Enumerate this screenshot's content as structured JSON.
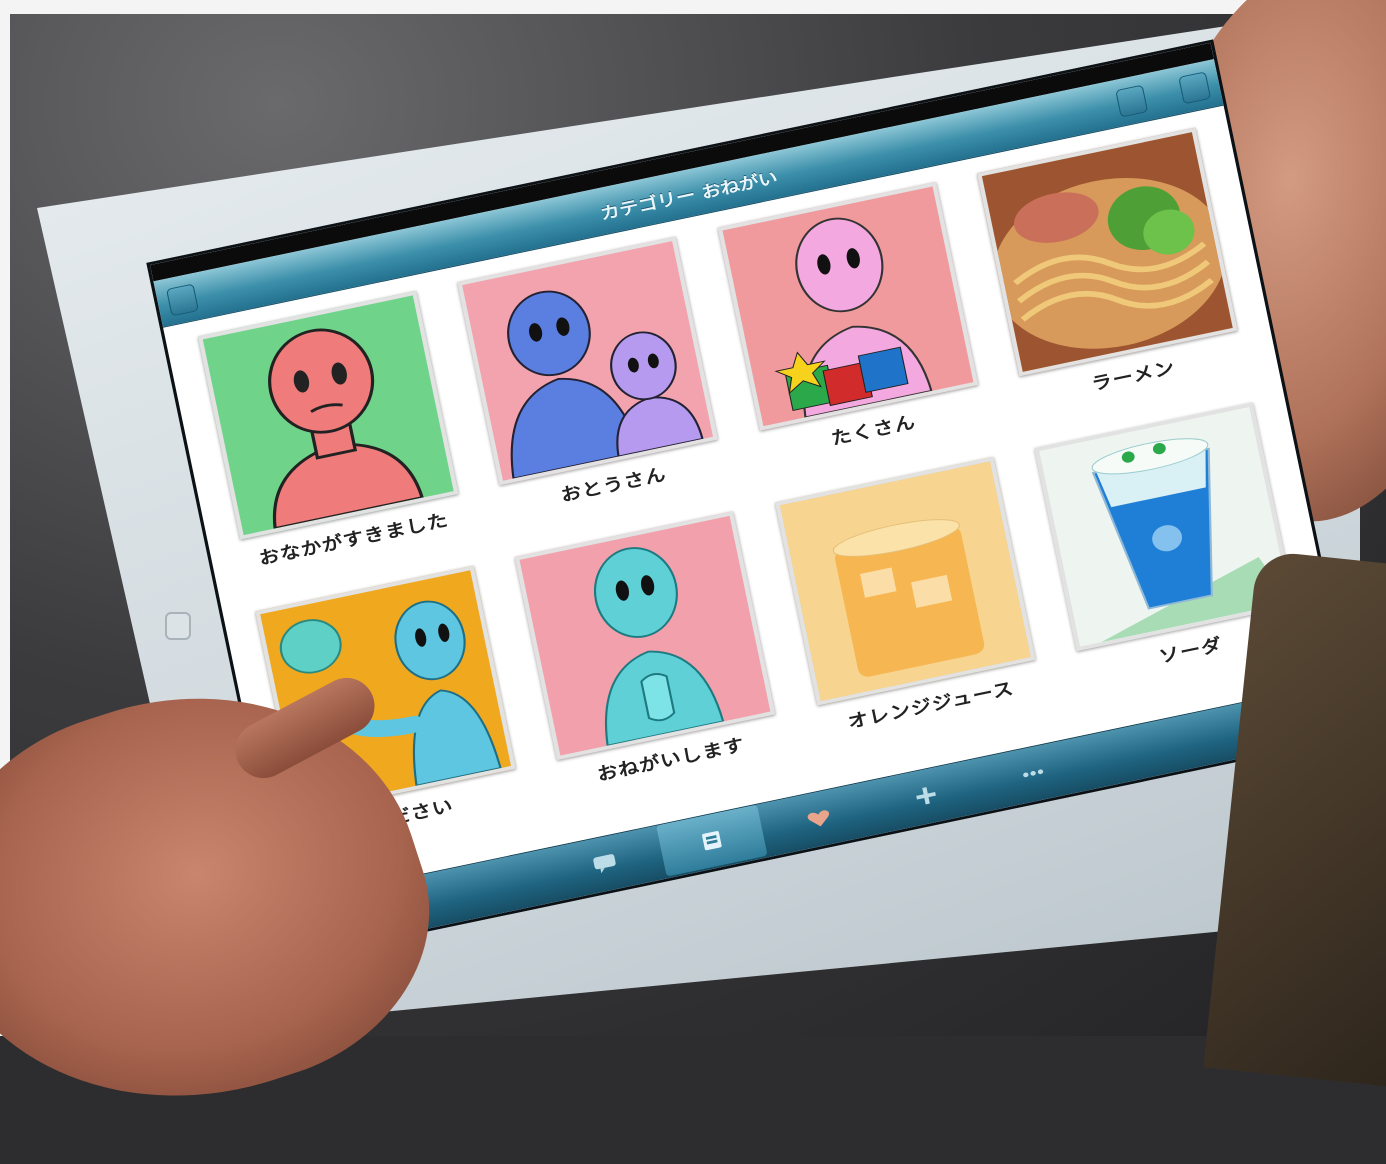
{
  "statusbar": {
    "left": "",
    "center": "",
    "right": ""
  },
  "navbar": {
    "title": "カテゴリー おねがい",
    "back_label": "",
    "edit_label": "",
    "done_label": ""
  },
  "cards": [
    {
      "label": "おなかがすきました",
      "icon": "hungry-figure",
      "bg": "#6fd48a"
    },
    {
      "label": "おとうさん",
      "icon": "father-figure",
      "bg": "#f2a3ad"
    },
    {
      "label": "たくさん",
      "icon": "many-gifts-figure",
      "bg": "#f09a9d"
    },
    {
      "label": "ラーメン",
      "icon": "ramen-photo",
      "bg": "#b86d3f"
    },
    {
      "label": "ください",
      "icon": "please-give-figure",
      "bg": "#f0a81e"
    },
    {
      "label": "おねがいします",
      "icon": "please-figure",
      "bg": "#f2a0ab"
    },
    {
      "label": "オレンジジュース",
      "icon": "orange-juice-photo",
      "bg": "#f3c46a"
    },
    {
      "label": "ソーダ",
      "icon": "soda-photo",
      "bg": "#e9f3ee"
    }
  ],
  "tabbar": {
    "tabs": [
      {
        "label": "",
        "icon": "chat-icon",
        "active": false
      },
      {
        "label": "",
        "icon": "category-icon",
        "active": true
      },
      {
        "label": "",
        "icon": "heart-icon",
        "active": false
      },
      {
        "label": "",
        "icon": "plus-icon",
        "active": false
      },
      {
        "label": "",
        "icon": "more-icon",
        "active": false
      }
    ]
  }
}
